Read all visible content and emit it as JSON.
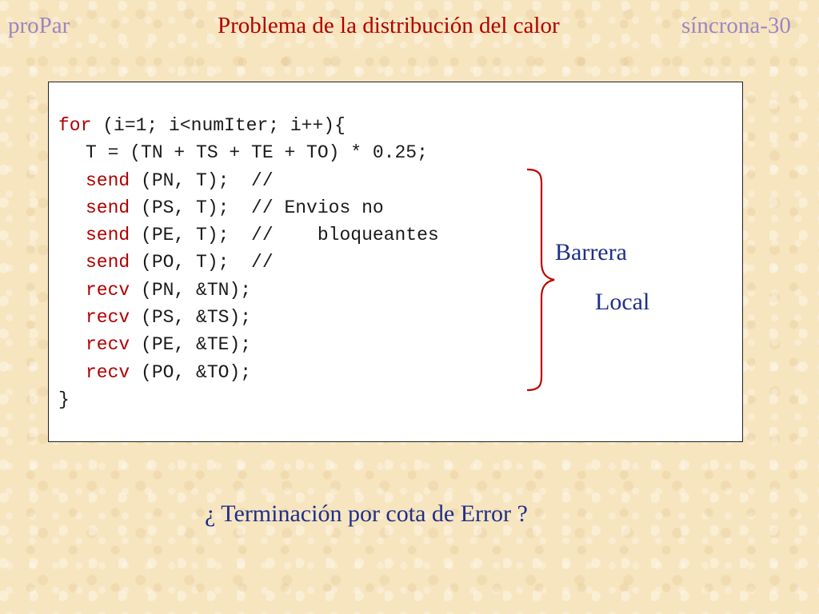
{
  "header": {
    "left": "proPar",
    "title": "Problema de la distribución del calor",
    "right": "síncrona-30"
  },
  "code": {
    "lines": [
      {
        "kw": "for",
        "rest": " (i=1; i<numIter; i++){"
      },
      {
        "kw": "",
        "rest": "T = (TN + TS + TE + TO) * 0.25;"
      },
      {
        "kw": "send",
        "rest": " (PN, T);  //"
      },
      {
        "kw": "send",
        "rest": " (PS, T);  // Envios no"
      },
      {
        "kw": "send",
        "rest": " (PE, T);  //    bloqueantes"
      },
      {
        "kw": "send",
        "rest": " (PO, T);  //"
      },
      {
        "kw": "recv",
        "rest": " (PN, &TN);"
      },
      {
        "kw": "recv",
        "rest": " (PS, &TS);"
      },
      {
        "kw": "recv",
        "rest": " (PE, &TE);"
      },
      {
        "kw": "recv",
        "rest": " (PO, &TO);"
      },
      {
        "kw": "",
        "rest": "}"
      }
    ]
  },
  "annotation": {
    "line1": "Barrera",
    "line2": "Local"
  },
  "question": "¿ Terminación por cota de Error ?",
  "colors": {
    "header_side": "#9d86c2",
    "title": "#b00000",
    "keyword": "#b00000",
    "annotation": "#1e2f8a",
    "brace": "#c00000"
  }
}
